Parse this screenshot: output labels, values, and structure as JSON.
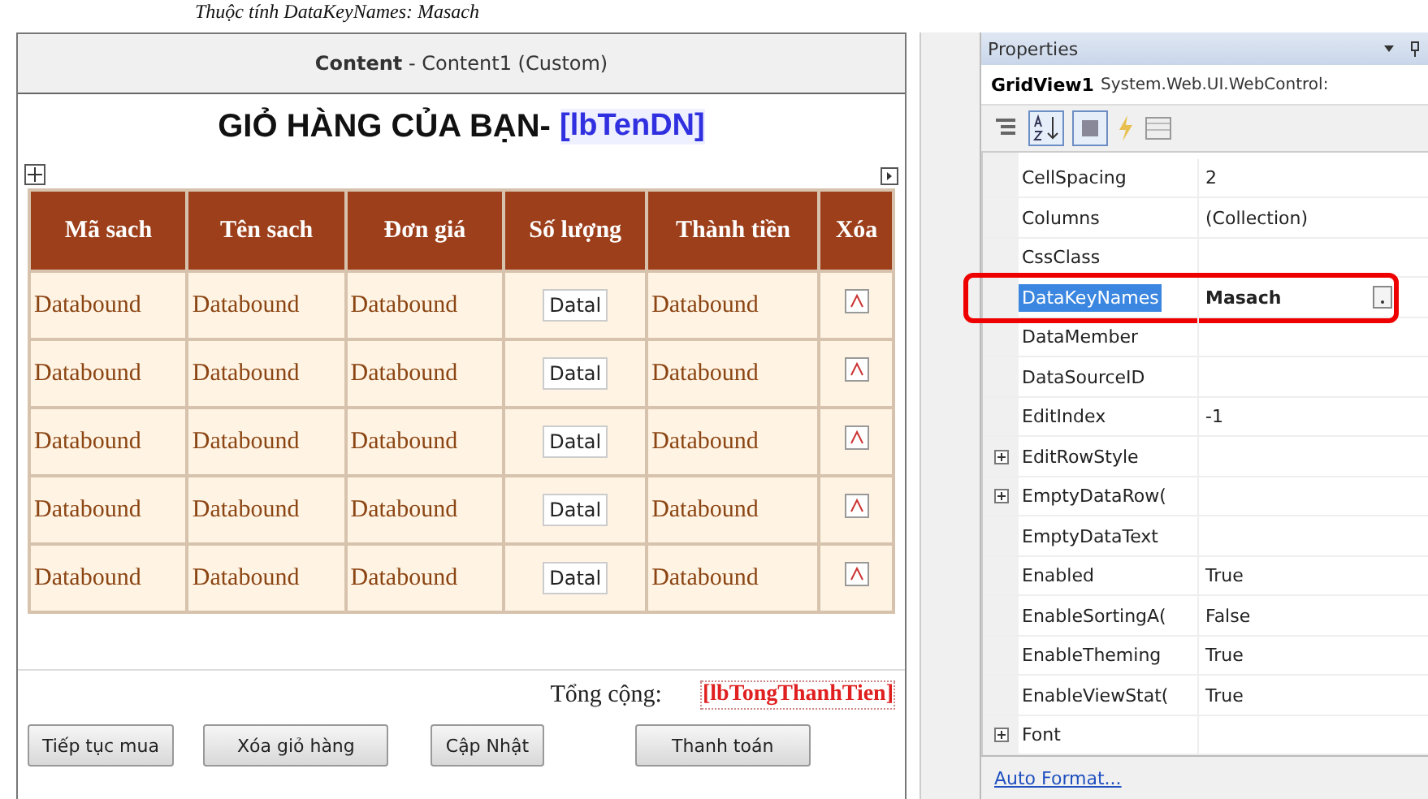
{
  "doc_caption": "Thuộc tính DataKeyNames: Masach",
  "designer": {
    "content_label": "Content",
    "content_sub": " - Content1 (Custom)",
    "heading": "GIỎ HÀNG CỦA BẠN- ",
    "heading_label": "[lbTenDN]",
    "table": {
      "columns": [
        "Mã sach",
        "Tên sach",
        "Đơn giá",
        "Số lượng",
        "Thành tiền",
        "Xóa"
      ],
      "rows": [
        [
          "Databound",
          "Databound",
          "Databound",
          "Datal",
          "Databound"
        ],
        [
          "Databound",
          "Databound",
          "Databound",
          "Datal",
          "Databound"
        ],
        [
          "Databound",
          "Databound",
          "Databound",
          "Datal",
          "Databound"
        ],
        [
          "Databound",
          "Databound",
          "Databound",
          "Datal",
          "Databound"
        ],
        [
          "Databound",
          "Databound",
          "Databound",
          "Datal",
          "Databound"
        ]
      ]
    },
    "total_label": "Tổng cộng:",
    "total_value": "[lbTongThanhTien]",
    "buttons": [
      "Tiếp tục mua",
      "Xóa giỏ hàng",
      "Cập Nhật",
      "Thanh toán"
    ]
  },
  "properties": {
    "title": "Properties",
    "object_name": "GridView1",
    "object_type": "System.Web.UI.WebControl:",
    "rows": [
      {
        "name": "CellSpacing",
        "value": "2",
        "expandable": false,
        "selected": false,
        "highlighted": false
      },
      {
        "name": "Columns",
        "value": "(Collection)",
        "expandable": false,
        "selected": false,
        "highlighted": false
      },
      {
        "name": "CssClass",
        "expandable": false,
        "selected": false,
        "highlighted": false
      },
      {
        "name": "DataKeyNames",
        "value": "Masach",
        "expandable": false,
        "selected": true,
        "highlighted": true
      },
      {
        "name": "DataMember",
        "expandable": false,
        "selected": false,
        "highlighted": false
      },
      {
        "name": "DataSourceID",
        "expandable": false,
        "selected": false,
        "highlighted": false
      },
      {
        "name": "EditIndex",
        "value": "-1",
        "expandable": false,
        "selected": false,
        "highlighted": false
      },
      {
        "name": "EditRowStyle",
        "expandable": true,
        "selected": false,
        "highlighted": false
      },
      {
        "name": "EmptyDataRow(",
        "expandable": true,
        "selected": false,
        "highlighted": false
      },
      {
        "name": "EmptyDataText",
        "expandable": false,
        "selected": false,
        "highlighted": false
      },
      {
        "name": "Enabled",
        "value": "True",
        "expandable": false,
        "selected": false,
        "highlighted": false
      },
      {
        "name": "EnableSortingA(",
        "value": "False",
        "expandable": false,
        "selected": false,
        "highlighted": false
      },
      {
        "name": "EnableTheming",
        "value": "True",
        "expandable": false,
        "selected": false,
        "highlighted": false
      },
      {
        "name": "EnableViewStat(",
        "value": "True",
        "expandable": false,
        "selected": false,
        "highlighted": false
      },
      {
        "name": "Font",
        "expandable": true,
        "selected": false,
        "highlighted": false
      }
    ],
    "link": "Auto Format..."
  }
}
